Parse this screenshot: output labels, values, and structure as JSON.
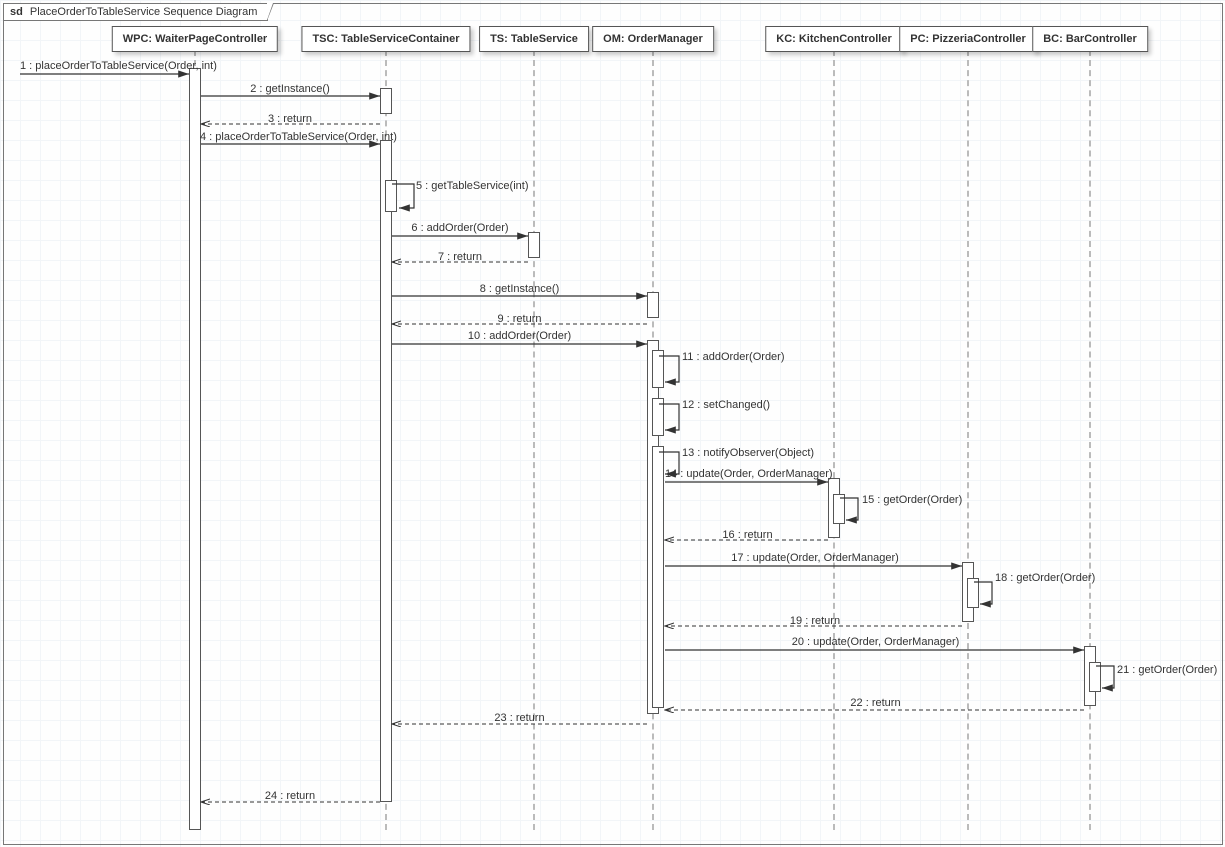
{
  "frame": {
    "sd": "sd",
    "title": "PlaceOrderToTableService Sequence Diagram"
  },
  "lifelines": {
    "wpc": "WPC: WaiterPageController",
    "tsc": "TSC: TableServiceContainer",
    "ts": "TS: TableService",
    "om": "OM: OrderManager",
    "kc": "KC: KitchenController",
    "pc": "PC: PizzeriaController",
    "bc": "BC: BarController"
  },
  "messages": {
    "m1": "1 : placeOrderToTableService(Order, int)",
    "m2": "2 : getInstance()",
    "m3": "3 : return",
    "m4": "4 : placeOrderToTableService(Order, int)",
    "m5": "5 : getTableService(int)",
    "m6": "6 : addOrder(Order)",
    "m7": "7 : return",
    "m8": "8 : getInstance()",
    "m9": "9 : return",
    "m10": "10 : addOrder(Order)",
    "m11": "11 : addOrder(Order)",
    "m12": "12 : setChanged()",
    "m13": "13 : notifyObserver(Object)",
    "m14": "14 : update(Order, OrderManager)",
    "m15": "15 : getOrder(Order)",
    "m16": "16 : return",
    "m17": "17 : update(Order, OrderManager)",
    "m18": "18 : getOrder(Order)",
    "m19": "19 : return",
    "m20": "20 : update(Order, OrderManager)",
    "m21": "21 : getOrder(Order)",
    "m22": "22 : return",
    "m23": "23 : return",
    "m24": "24 : return"
  },
  "chart_data": {
    "type": "sequence-diagram",
    "title": "PlaceOrderToTableService Sequence Diagram",
    "participants": [
      {
        "id": "WPC",
        "label": "WaiterPageController"
      },
      {
        "id": "TSC",
        "label": "TableServiceContainer"
      },
      {
        "id": "TS",
        "label": "TableService"
      },
      {
        "id": "OM",
        "label": "OrderManager"
      },
      {
        "id": "KC",
        "label": "KitchenController"
      },
      {
        "id": "PC",
        "label": "PizzeriaController"
      },
      {
        "id": "BC",
        "label": "BarController"
      }
    ],
    "messages": [
      {
        "n": 1,
        "from": "external",
        "to": "WPC",
        "label": "placeOrderToTableService(Order, int)",
        "kind": "call"
      },
      {
        "n": 2,
        "from": "WPC",
        "to": "TSC",
        "label": "getInstance()",
        "kind": "call"
      },
      {
        "n": 3,
        "from": "TSC",
        "to": "WPC",
        "label": "return",
        "kind": "return"
      },
      {
        "n": 4,
        "from": "WPC",
        "to": "TSC",
        "label": "placeOrderToTableService(Order, int)",
        "kind": "call"
      },
      {
        "n": 5,
        "from": "TSC",
        "to": "TSC",
        "label": "getTableService(int)",
        "kind": "self"
      },
      {
        "n": 6,
        "from": "TSC",
        "to": "TS",
        "label": "addOrder(Order)",
        "kind": "call"
      },
      {
        "n": 7,
        "from": "TS",
        "to": "TSC",
        "label": "return",
        "kind": "return"
      },
      {
        "n": 8,
        "from": "TSC",
        "to": "OM",
        "label": "getInstance()",
        "kind": "call"
      },
      {
        "n": 9,
        "from": "OM",
        "to": "TSC",
        "label": "return",
        "kind": "return"
      },
      {
        "n": 10,
        "from": "TSC",
        "to": "OM",
        "label": "addOrder(Order)",
        "kind": "call"
      },
      {
        "n": 11,
        "from": "OM",
        "to": "OM",
        "label": "addOrder(Order)",
        "kind": "self"
      },
      {
        "n": 12,
        "from": "OM",
        "to": "OM",
        "label": "setChanged()",
        "kind": "self"
      },
      {
        "n": 13,
        "from": "OM",
        "to": "OM",
        "label": "notifyObserver(Object)",
        "kind": "self"
      },
      {
        "n": 14,
        "from": "OM",
        "to": "KC",
        "label": "update(Order, OrderManager)",
        "kind": "call"
      },
      {
        "n": 15,
        "from": "KC",
        "to": "KC",
        "label": "getOrder(Order)",
        "kind": "self"
      },
      {
        "n": 16,
        "from": "KC",
        "to": "OM",
        "label": "return",
        "kind": "return"
      },
      {
        "n": 17,
        "from": "OM",
        "to": "PC",
        "label": "update(Order, OrderManager)",
        "kind": "call"
      },
      {
        "n": 18,
        "from": "PC",
        "to": "PC",
        "label": "getOrder(Order)",
        "kind": "self"
      },
      {
        "n": 19,
        "from": "PC",
        "to": "OM",
        "label": "return",
        "kind": "return"
      },
      {
        "n": 20,
        "from": "OM",
        "to": "BC",
        "label": "update(Order, OrderManager)",
        "kind": "call"
      },
      {
        "n": 21,
        "from": "BC",
        "to": "BC",
        "label": "getOrder(Order)",
        "kind": "self"
      },
      {
        "n": 22,
        "from": "BC",
        "to": "OM",
        "label": "return",
        "kind": "return"
      },
      {
        "n": 23,
        "from": "OM",
        "to": "TSC",
        "label": "return",
        "kind": "return"
      },
      {
        "n": 24,
        "from": "TSC",
        "to": "WPC",
        "label": "return",
        "kind": "return"
      }
    ]
  }
}
